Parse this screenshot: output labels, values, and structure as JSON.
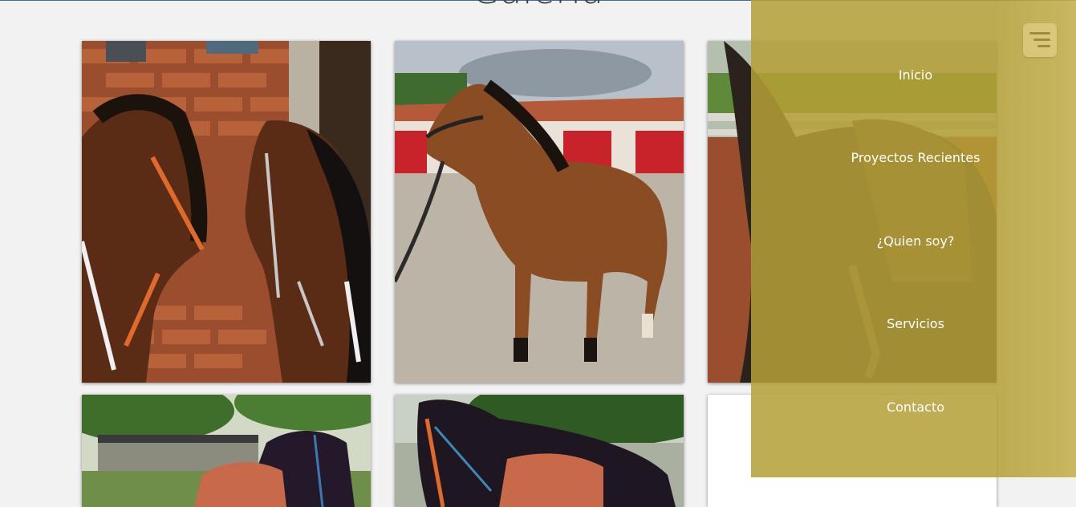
{
  "page": {
    "title": "Galería"
  },
  "gallery": {
    "photos": [
      {
        "subject": "two bay horses facing each other by a brick wall"
      },
      {
        "subject": "bay horse standing in a stable courtyard"
      },
      {
        "subject": "dark horse with saddle in an arena"
      },
      {
        "subject": "dark horse with saddle under trees"
      },
      {
        "subject": "dark horse with decorated saddle"
      },
      {
        "subject": "blank image tile"
      }
    ]
  },
  "menu": {
    "items": [
      {
        "label": "Inicio"
      },
      {
        "label": "Proyectos Recientes"
      },
      {
        "label": "¿Quien soy?"
      },
      {
        "label": "Servicios"
      },
      {
        "label": "Contacto"
      }
    ],
    "overlay_color": "#b4a037",
    "toggle_icon": "hamburger-menu-icon"
  }
}
